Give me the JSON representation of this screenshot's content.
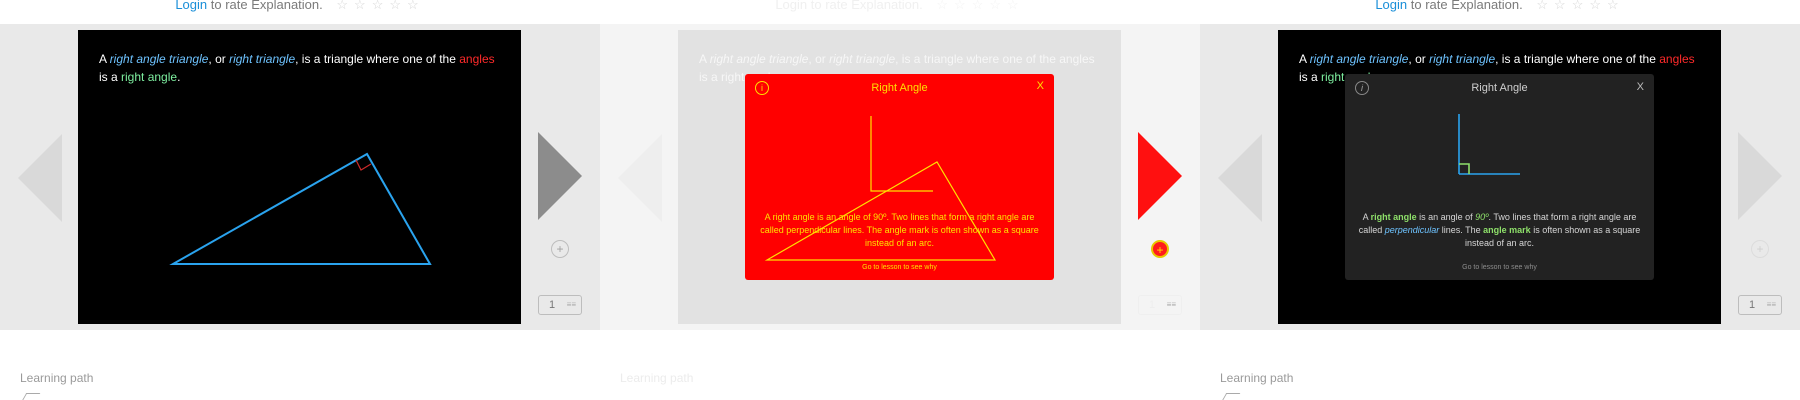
{
  "rating": {
    "login": "Login",
    "rest": " to rate Explanation.",
    "stars": "☆☆☆☆☆"
  },
  "slide": {
    "t1": "A ",
    "t2": "right angle triangle",
    "t3": ", or ",
    "t4": "right triangle",
    "t5": ", is a triangle where one of the ",
    "t6": "angles",
    "t7": " is a ",
    "t8": "right angle",
    "t9": "."
  },
  "popover": {
    "title": "Right Angle",
    "close": "X",
    "info": "i",
    "b1": "A ",
    "b2": "right angle",
    "b3": " is an angle of ",
    "b4": "90º",
    "b5": ". Two lines that form a right angle are called ",
    "b6": "perpendicular",
    "b7": " lines. The ",
    "b8": "angle mark",
    "b9": " is often shown as a square instead of an arc.",
    "link": "Go to lesson to see why"
  },
  "controls": {
    "page": "1",
    "toggle": "≡≡",
    "add": "+"
  },
  "learning_path": "Learning path",
  "colors": {
    "accent_blue": "#1a8fd8",
    "triangle": "#2aa3ee",
    "right_mark": "#cc2a2a",
    "highlight_red": "#ff0000",
    "highlight_yellow": "#ffe000"
  }
}
